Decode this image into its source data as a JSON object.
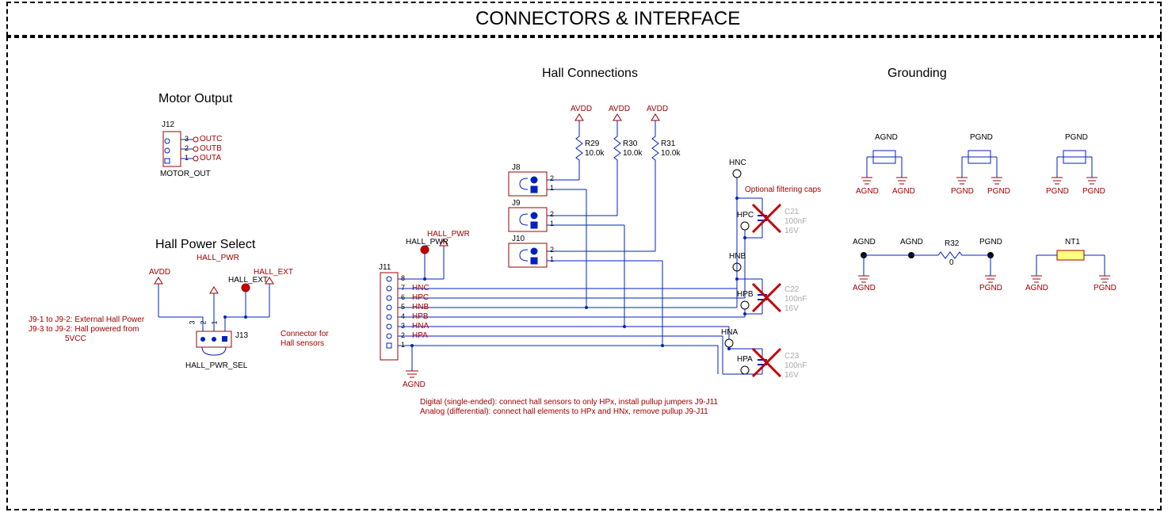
{
  "title": "CONNECTORS & INTERFACE",
  "sections": {
    "motor_output": "Motor Output",
    "hall_power_select": "Hall Power Select",
    "hall_connections": "Hall Connections",
    "grounding": "Grounding"
  },
  "motor_output": {
    "refdes": "J12",
    "name": "MOTOR_OUT",
    "pins": [
      {
        "num": "3",
        "net": "OUTC"
      },
      {
        "num": "2",
        "net": "OUTB"
      },
      {
        "num": "1",
        "net": "OUTA"
      }
    ]
  },
  "hall_power_select": {
    "refdes": "J13",
    "name": "HALL_PWR_SEL",
    "pins": [
      "3",
      "2",
      "1"
    ],
    "nets": {
      "avdd": "AVDD",
      "hall_pwr": "HALL_PWR",
      "hall_ext": "HALL_EXT",
      "hall_ext_tp": "HALL_EXT"
    },
    "note_lines": [
      "J9-1 to J9-2: External Hall Power",
      "J9-3 to J9-2: Hall powered from",
      "5VCC"
    ],
    "connector_note": [
      "Connector for",
      "Hall sensors"
    ]
  },
  "hall_connections": {
    "power_nets": [
      "AVDD",
      "AVDD",
      "AVDD"
    ],
    "pullups": [
      {
        "refdes": "R29",
        "value": "10.0k"
      },
      {
        "refdes": "R30",
        "value": "10.0k"
      },
      {
        "refdes": "R31",
        "value": "10.0k"
      }
    ],
    "jumpers": [
      {
        "refdes": "J8",
        "pins": [
          "2",
          "1"
        ]
      },
      {
        "refdes": "J9",
        "pins": [
          "2",
          "1"
        ]
      },
      {
        "refdes": "J10",
        "pins": [
          "2",
          "1"
        ]
      }
    ],
    "connector": {
      "refdes": "J11",
      "hall_pwr_net": "HALL_PWR",
      "hall_pwr_label": "HALL_PWR",
      "pins": [
        {
          "num": "8",
          "net": ""
        },
        {
          "num": "7",
          "net": "HNC"
        },
        {
          "num": "6",
          "net": "HPC"
        },
        {
          "num": "5",
          "net": "HNB"
        },
        {
          "num": "4",
          "net": "HPB"
        },
        {
          "num": "3",
          "net": "HNA"
        },
        {
          "num": "2",
          "net": "HPA"
        },
        {
          "num": "1",
          "net": ""
        }
      ],
      "gnd": "AGND"
    },
    "test_points": [
      "HNC",
      "HPC",
      "HNB",
      "HPB",
      "HNA",
      "HPA"
    ],
    "dnp_caps": [
      {
        "refdes": "C21",
        "value": "100nF",
        "volt": "16V"
      },
      {
        "refdes": "C22",
        "value": "100nF",
        "volt": "16V"
      },
      {
        "refdes": "C23",
        "value": "100nF",
        "volt": "16V"
      }
    ],
    "filter_note": "Optional filtering caps",
    "bottom_note_lines": [
      "Digital (single-ended): connect hall sensors to only HPx, install pullup jumpers J9-J11",
      "Analog (differential): connect hall elements to HPx and HNx, remove pullup J9-J11"
    ]
  },
  "grounding": {
    "caps": [
      {
        "net": "AGND",
        "left": "AGND",
        "right": "AGND"
      },
      {
        "net": "PGND",
        "left": "PGND",
        "right": "PGND"
      },
      {
        "net": "PGND",
        "left": "PGND",
        "right": "PGND"
      }
    ],
    "bridge": {
      "agnd1": "AGND",
      "agnd2": "AGND",
      "pgnd": "PGND",
      "r": {
        "refdes": "R32",
        "value": "0"
      },
      "left_gnd": "AGND",
      "right_gnd": "PGND"
    },
    "nt": {
      "refdes": "NT1",
      "left": "AGND",
      "right": "PGND"
    }
  }
}
